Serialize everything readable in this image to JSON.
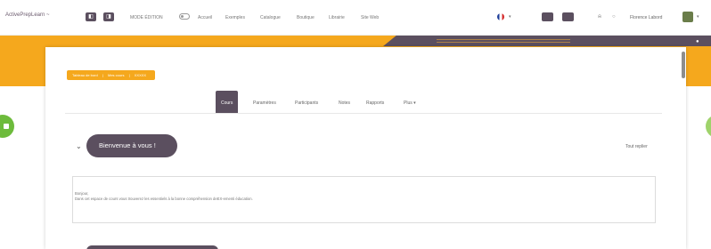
{
  "topbar": {
    "logo_text": "ActivePrepLearn ~",
    "logo_sub": "",
    "mode_label": "MODE ÉDITION",
    "nav_items": [
      "Accueil",
      "Exemples",
      "Catalogue",
      "Boutique",
      "Librairie",
      "Site Web"
    ],
    "language_caret": "▾",
    "user_name": "Florence Labord",
    "user_caret": "▾",
    "bell_icon": "⍾",
    "chat_icon": "○"
  },
  "breadcrumb": {
    "items": [
      "Tableau de bord",
      "Mes cours",
      "XXXXX"
    ]
  },
  "tabs": [
    "Cours",
    "Paramètres",
    "Participants",
    "Notes",
    "Rapports",
    "Plus ▾"
  ],
  "section": {
    "title": "Bienvenue à vous !",
    "expand_all": "Tout replier"
  },
  "info_box": {
    "line1": "Bonjour,",
    "line2": "Dans cet espace de cours vous trouverez les essentiels à la bonne compréhension deEX-ementi éducation."
  },
  "colors": {
    "accent_orange": "#f5a81d",
    "accent_purple": "#5b4f5f",
    "green": "#6dbb3c"
  }
}
